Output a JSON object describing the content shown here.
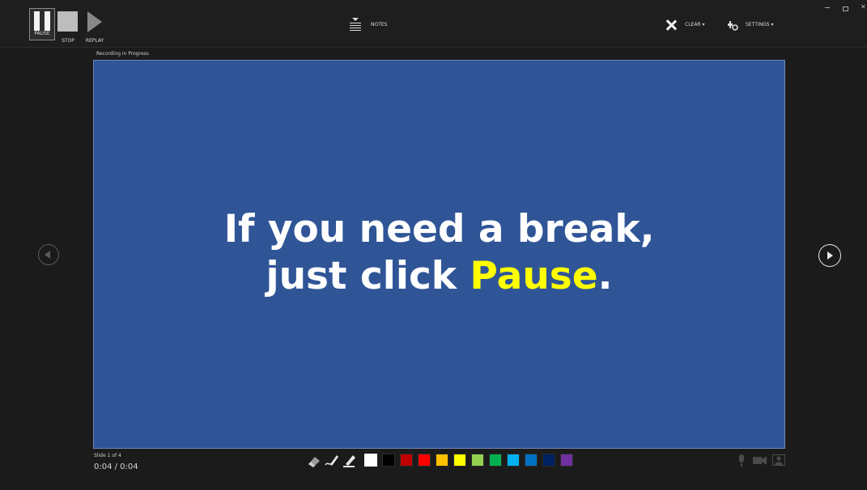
{
  "toolbar": {
    "pause_label": "PAUSE",
    "stop_label": "STOP",
    "replay_label": "REPLAY",
    "notes_label": "NOTES",
    "clear_label": "CLEAR ▾",
    "settings_label": "SETTINGS ▾"
  },
  "status": {
    "recording": "Recording in Progress",
    "slide_count": "Slide 1 of 4",
    "time": "0:04 / 0:04"
  },
  "slide": {
    "line1": "If you need a break,",
    "line2_prefix": "just click ",
    "line2_highlight": "Pause",
    "line2_suffix": ".",
    "background": "#305597",
    "highlight_color": "#ffff00"
  },
  "pen_colors": [
    "#ffffff",
    "#000000",
    "#c00000",
    "#ff0000",
    "#ffc000",
    "#ffff00",
    "#92d050",
    "#00b050",
    "#00b0f0",
    "#0070c0",
    "#002060",
    "#7030a0"
  ],
  "icons": {
    "eraser": "eraser-icon",
    "pen": "pen-icon",
    "highlighter": "highlighter-icon",
    "microphone": "microphone-icon",
    "camera": "camera-icon",
    "camera_preview": "camera-preview-icon"
  }
}
